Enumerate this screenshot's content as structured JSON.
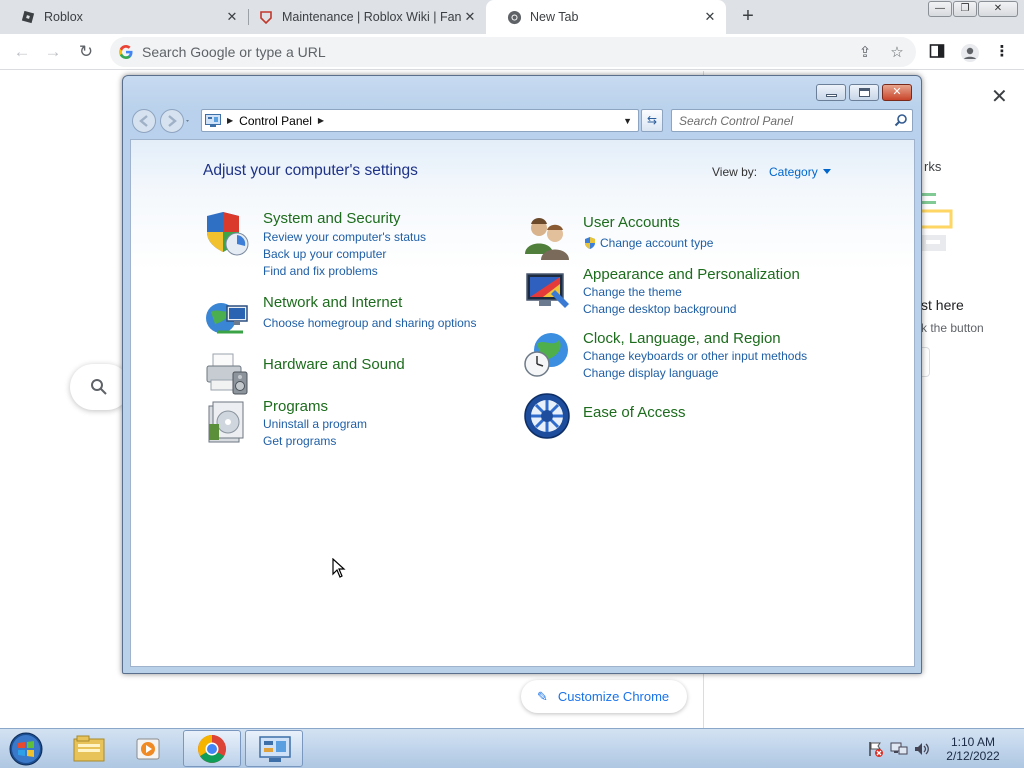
{
  "browser": {
    "tabs": [
      {
        "title": "Roblox",
        "icon": "roblox-icon"
      },
      {
        "title": "Maintenance | Roblox Wiki | Fand",
        "icon": "fandom-icon"
      },
      {
        "title": "New Tab",
        "icon": "chrome-icon"
      }
    ],
    "omnibox_placeholder": "Search Google or type a URL",
    "side_panel": {
      "title": "rks",
      "heading": "st here",
      "subtext": "k the button"
    },
    "customize_label": "Customize Chrome"
  },
  "control_panel": {
    "breadcrumb": "Control Panel",
    "search_placeholder": "Search Control Panel",
    "heading": "Adjust your computer's settings",
    "view_by_label": "View by:",
    "view_by_value": "Category",
    "categories_left": [
      {
        "name": "System and Security",
        "icon": "shield-icon",
        "links": [
          "Review your computer's status",
          "Back up your computer",
          "Find and fix problems"
        ]
      },
      {
        "name": "Network and Internet",
        "icon": "network-icon",
        "links": [
          "Choose homegroup and sharing options"
        ]
      },
      {
        "name": "Hardware and Sound",
        "icon": "printer-icon",
        "links": []
      },
      {
        "name": "Programs",
        "icon": "programs-icon",
        "links": [
          "Uninstall a program",
          "Get programs"
        ]
      }
    ],
    "categories_right": [
      {
        "name": "User Accounts",
        "icon": "users-icon",
        "links": [
          "Change account type"
        ]
      },
      {
        "name": "Appearance and Personalization",
        "icon": "appearance-icon",
        "links": [
          "Change the theme",
          "Change desktop background"
        ]
      },
      {
        "name": "Clock, Language, and Region",
        "icon": "globe-clock-icon",
        "links": [
          "Change keyboards or other input methods",
          "Change display language"
        ]
      },
      {
        "name": "Ease of Access",
        "icon": "ease-of-access-icon",
        "links": []
      }
    ]
  },
  "taskbar": {
    "time": "1:10 AM",
    "date": "2/12/2022"
  },
  "colors": {
    "category_green": "#1d6c1d",
    "link_blue": "#1f5fa6",
    "heading_blue": "#1e3287",
    "chrome_blue": "#1a73e8"
  }
}
